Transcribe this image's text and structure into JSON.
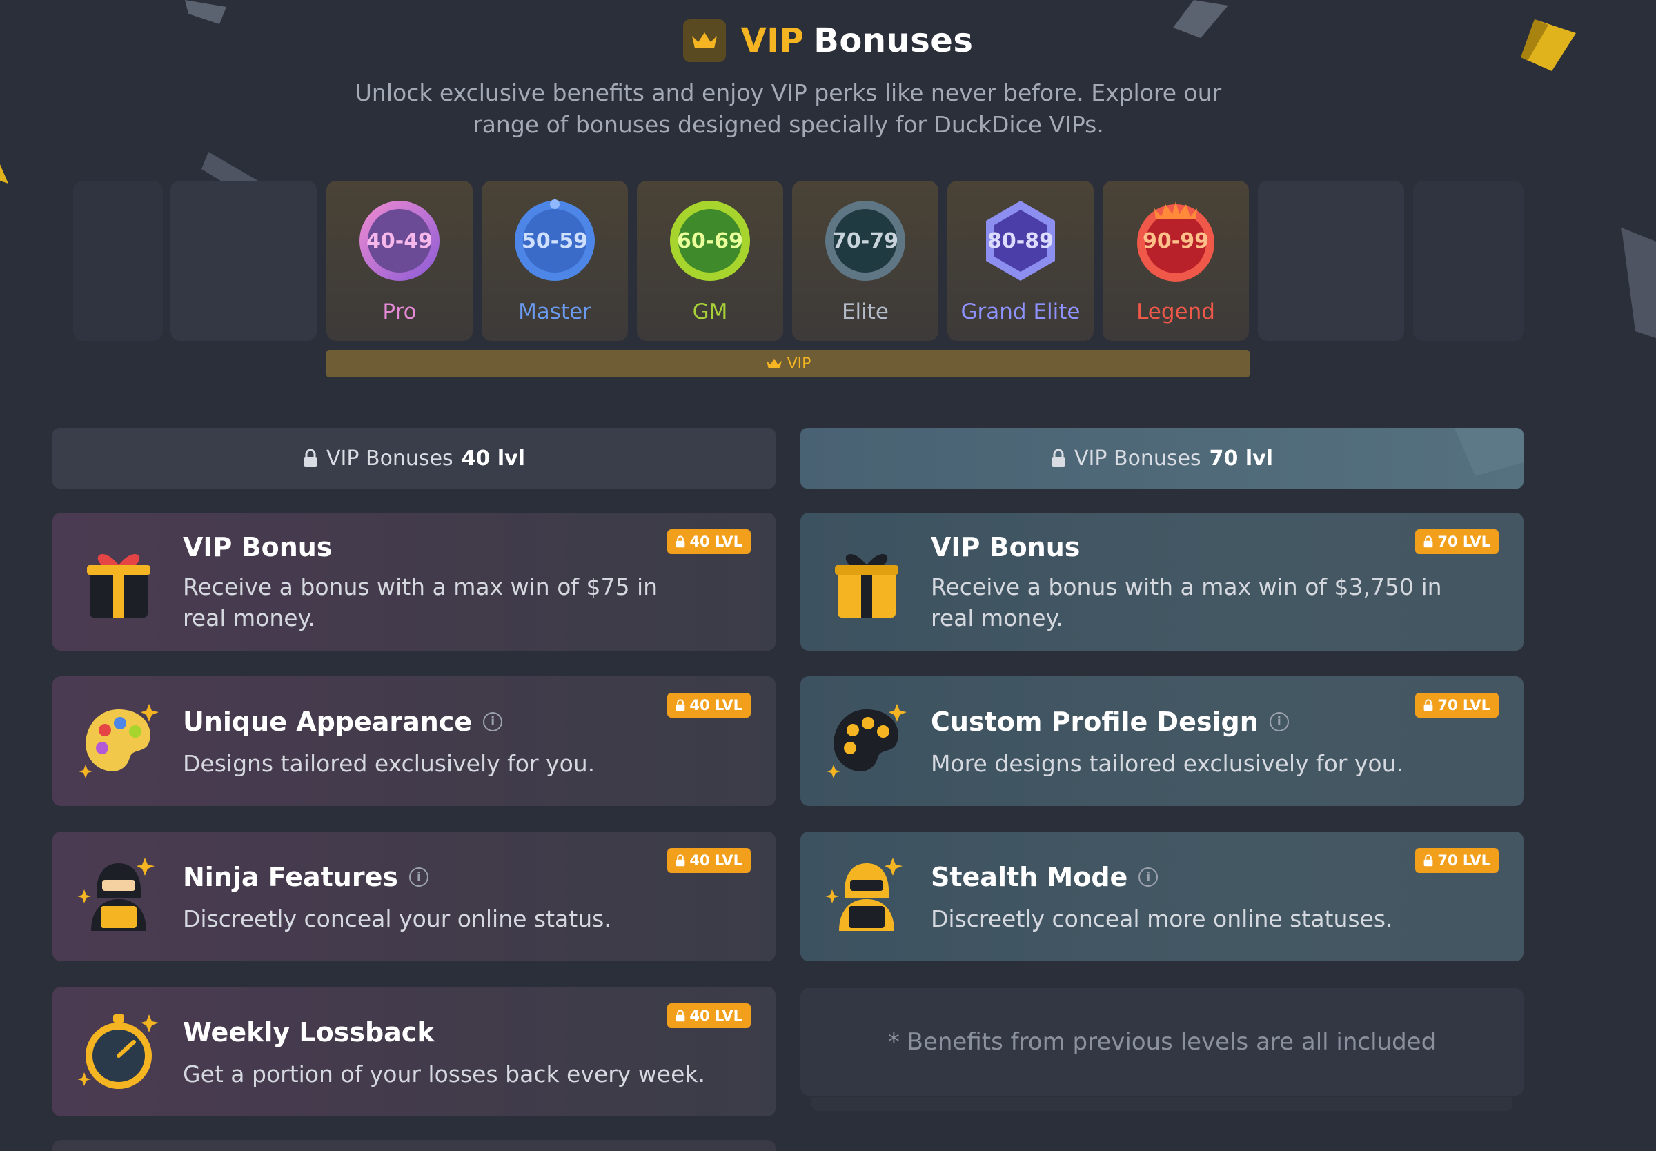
{
  "header": {
    "title_vip": "VIP",
    "title_rest": "Bonuses",
    "subtitle_line1": "Unlock exclusive benefits and enjoy VIP perks like never before. Explore our",
    "subtitle_line2": "range of bonuses designed specially for DuckDice VIPs.",
    "accent": "#f5b522"
  },
  "levels": [
    {
      "range": "40-49",
      "name": "Pro",
      "color": "#e58ad6"
    },
    {
      "range": "50-59",
      "name": "Master",
      "color": "#6a9bf0"
    },
    {
      "range": "60-69",
      "name": "GM",
      "color": "#a7d137"
    },
    {
      "range": "70-79",
      "name": "Elite",
      "color": "#b3bcc8"
    },
    {
      "range": "80-89",
      "name": "Grand Elite",
      "color": "#8f93ff"
    },
    {
      "range": "90-99",
      "name": "Legend",
      "color": "#f0584a"
    }
  ],
  "vip_bar_label": "VIP",
  "columns": {
    "left": {
      "prefix": "VIP  Bonuses",
      "level": "40 lvl"
    },
    "right": {
      "prefix": "VIP  Bonuses",
      "level": "70 lvl"
    }
  },
  "cards_left": [
    {
      "title": "VIP Bonus",
      "desc": "Receive a bonus with a max win of $75 in real money.",
      "badge": "40 LVL",
      "icon": "gift-icon"
    },
    {
      "title": "Unique Appearance",
      "desc": "Designs tailored exclusively for you.",
      "badge": "40 LVL",
      "icon": "palette-icon"
    },
    {
      "title": "Ninja Features",
      "desc": "Discreetly conceal your online status.",
      "badge": "40 LVL",
      "icon": "ninja-icon"
    },
    {
      "title": "Weekly Lossback",
      "desc": "Get a portion of your losses back every week.",
      "badge": "40 LVL",
      "icon": "stopwatch-icon"
    }
  ],
  "cards_right": [
    {
      "title": "VIP Bonus",
      "desc": "Receive a bonus with a max win of $3,750 in real money.",
      "badge": "70 LVL",
      "icon": "gift-icon"
    },
    {
      "title": "Custom Profile Design",
      "desc": "More designs tailored exclusively for you.",
      "badge": "70 LVL",
      "icon": "palette-icon"
    },
    {
      "title": "Stealth Mode",
      "desc": "Discreetly conceal more online statuses.",
      "badge": "70 LVL",
      "icon": "ninja-icon"
    }
  ],
  "note": "* Benefits from previous levels are all included"
}
